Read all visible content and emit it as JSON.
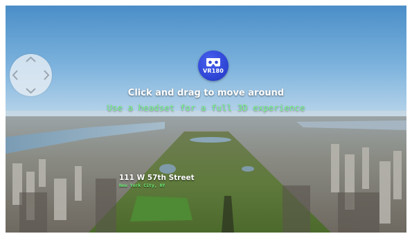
{
  "viewer": {
    "badge_label": "VR180",
    "instruction_main": "Click and drag to move around",
    "instruction_sub": "Use a headset for a full 3D experience"
  },
  "location": {
    "title": "111 W 57th Street",
    "subtitle": "New York City, NY"
  },
  "icons": {
    "navigation": "directional-pad-icon",
    "vr_headset": "vr-headset-icon"
  },
  "colors": {
    "accent_green": "#7cf58a",
    "badge_blue": "#2f46d6"
  }
}
